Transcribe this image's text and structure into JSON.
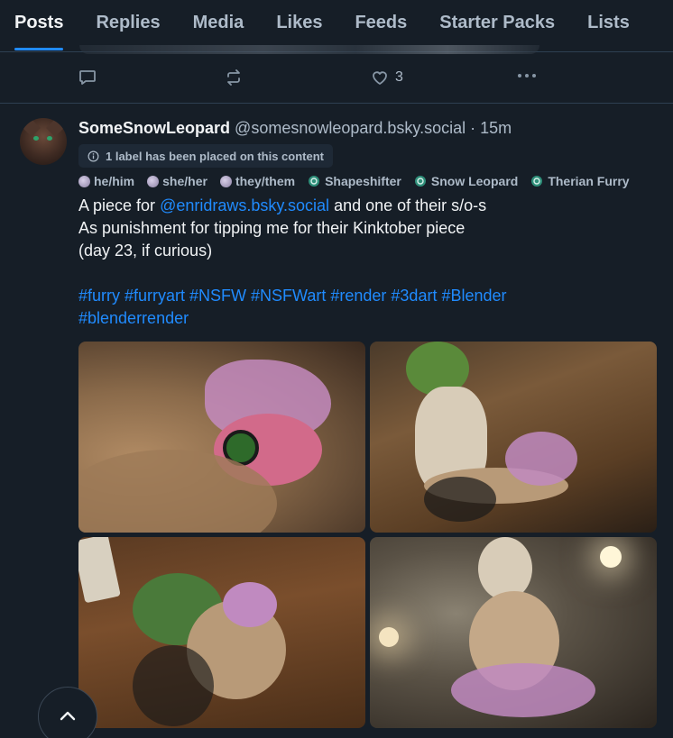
{
  "tabs": [
    {
      "label": "Posts",
      "active": true
    },
    {
      "label": "Replies",
      "active": false
    },
    {
      "label": "Media",
      "active": false
    },
    {
      "label": "Likes",
      "active": false
    },
    {
      "label": "Feeds",
      "active": false
    },
    {
      "label": "Starter Packs",
      "active": false
    },
    {
      "label": "Lists",
      "active": false
    }
  ],
  "previous_post": {
    "icons": [
      "reply-icon",
      "repost-icon",
      "like-icon",
      "more-icon"
    ],
    "like_count": "3"
  },
  "post": {
    "author_name": "SomeSnowLeopard",
    "author_handle": "@somesnowleopard.bsky.social · 15m",
    "label_notice": "1 label has been placed on this content",
    "profile_labels": [
      "he/him",
      "she/her",
      "they/them",
      "Shapeshifter",
      "Snow Leopard",
      "Therian Furry"
    ],
    "text_line1_prefix": "A piece for ",
    "mention": "@enridraws.bsky.social",
    "text_line1_suffix": " and one of their s/o-s",
    "text_line2": "As punishment for tipping me for their Kinktober piece",
    "text_line3": "(day 23, if curious)",
    "hashtags_line1": "#furry #furryart #NSFW #NSFWart #render #3dart #Blender",
    "hashtags_line2": "#blenderrender",
    "images": [
      "image-1",
      "image-2",
      "image-3",
      "image-4"
    ]
  },
  "colors": {
    "background": "#161e27",
    "accent": "#208bfe",
    "text_primary": "#f1f3f5",
    "text_secondary": "#aebbc9",
    "border": "#2e4052"
  }
}
